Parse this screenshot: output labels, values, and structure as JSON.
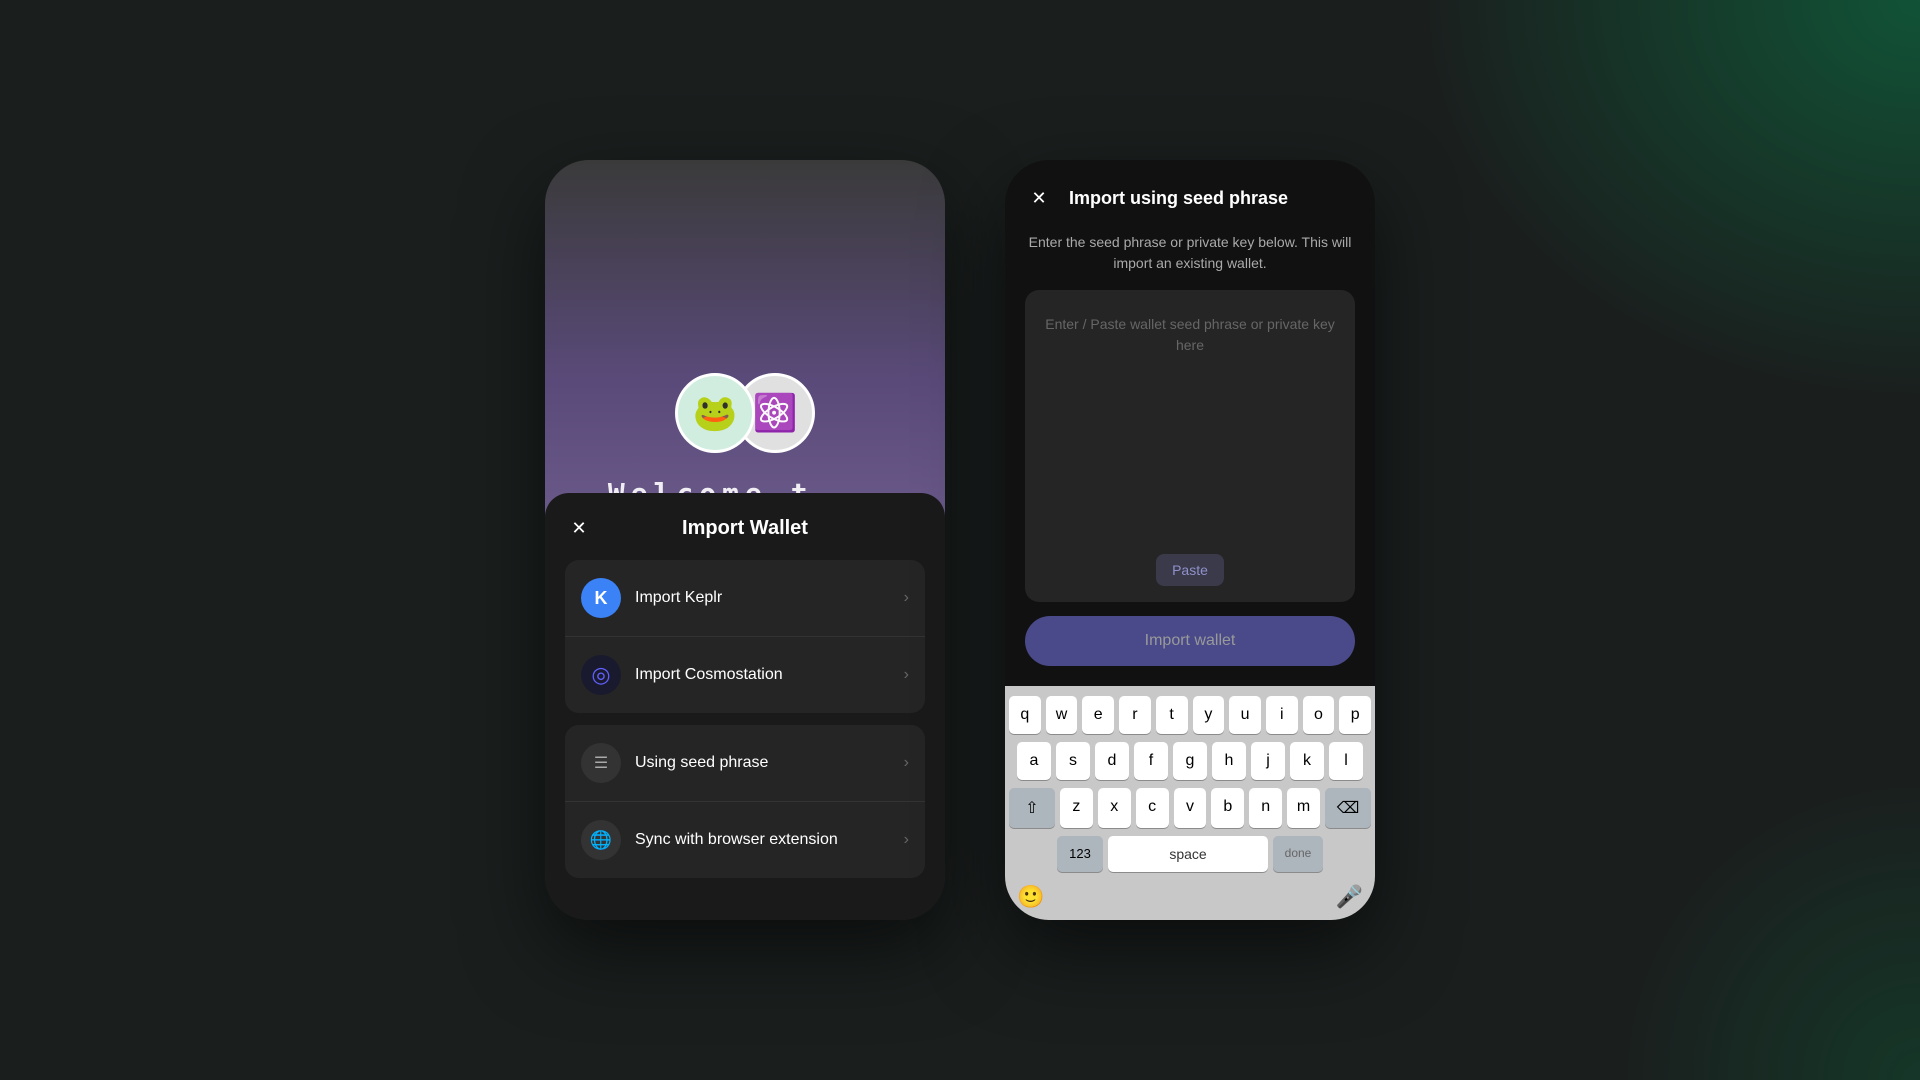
{
  "background": {
    "color": "#1a1f1e"
  },
  "left_phone": {
    "top_area": {
      "logos": [
        {
          "name": "frog-logo",
          "emoji": "🐸"
        },
        {
          "name": "atom-logo",
          "emoji": "⚛️"
        }
      ],
      "welcome_text_partial": "Welcome t..."
    },
    "modal": {
      "title": "Import Wallet",
      "close_label": "×",
      "menu_items": [
        {
          "id": "import-keplr",
          "icon_type": "keplr",
          "icon_label": "K",
          "label": "Import Keplr",
          "group": 1
        },
        {
          "id": "import-cosmostation",
          "icon_type": "cosmostation",
          "icon_label": "◎",
          "label": "Import Cosmostation",
          "group": 1
        },
        {
          "id": "using-seed-phrase",
          "icon_type": "seed",
          "icon_label": "☰",
          "label": "Using seed phrase",
          "group": 2
        },
        {
          "id": "sync-browser",
          "icon_type": "browser",
          "icon_label": "🌐",
          "label": "Sync with browser extension",
          "group": 2
        }
      ]
    }
  },
  "right_phone": {
    "modal": {
      "title": "Import using seed phrase",
      "close_label": "×",
      "subtitle": "Enter the seed phrase or private key below. This will import an existing wallet.",
      "input_placeholder": "Enter / Paste wallet seed phrase or private key here",
      "paste_button_label": "Paste",
      "import_button_label": "Import wallet"
    },
    "keyboard": {
      "rows": [
        [
          "q",
          "w",
          "e",
          "r",
          "t",
          "y",
          "u",
          "i",
          "o",
          "p"
        ],
        [
          "a",
          "s",
          "d",
          "f",
          "g",
          "h",
          "j",
          "k",
          "l"
        ],
        [
          "z",
          "x",
          "c",
          "v",
          "b",
          "n",
          "m"
        ]
      ],
      "space_label": "space",
      "done_label": "done",
      "num_label": "123",
      "backspace_icon": "⌫",
      "shift_icon": "⇧",
      "emoji_icon": "🙂",
      "mic_icon": "🎤"
    }
  }
}
